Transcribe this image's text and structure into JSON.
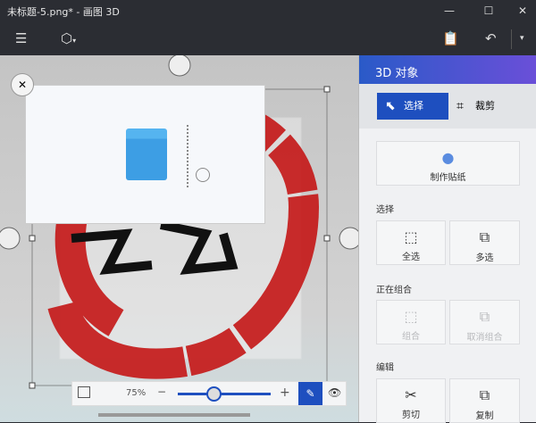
{
  "window": {
    "title": "未标题-5.png* - 画图 3D",
    "minimize_icon": "minimize-icon",
    "maximize_icon": "maximize-icon",
    "close_icon": "close-icon"
  },
  "toolbar": {
    "menu_icon": "hamburger-icon",
    "object_icon": "cube-icon",
    "paste_icon": "clipboard-icon",
    "undo_icon": "undo-icon"
  },
  "panel": {
    "title": "3D 对象",
    "modes": [
      {
        "label": "选择",
        "icon": "cursor-icon",
        "active": true
      },
      {
        "label": "裁剪",
        "icon": "crop-icon",
        "active": false
      }
    ],
    "sticker": {
      "label": "制作贴纸",
      "icon": "sticker-icon"
    },
    "select_section": "选择",
    "select_all": "全选",
    "multi_select": "多选",
    "group_section": "正在组合",
    "group": "组合",
    "ungroup": "取消组合",
    "edit_section": "编辑",
    "cut": "剪切",
    "copy": "复制"
  },
  "zoom": {
    "level": "75%",
    "value_percent": 75,
    "minus": "−",
    "plus": "+"
  },
  "colors": {
    "accent": "#1e4fbf",
    "brush_red": "#c41a1a",
    "titlebar": "#2b2d33"
  }
}
